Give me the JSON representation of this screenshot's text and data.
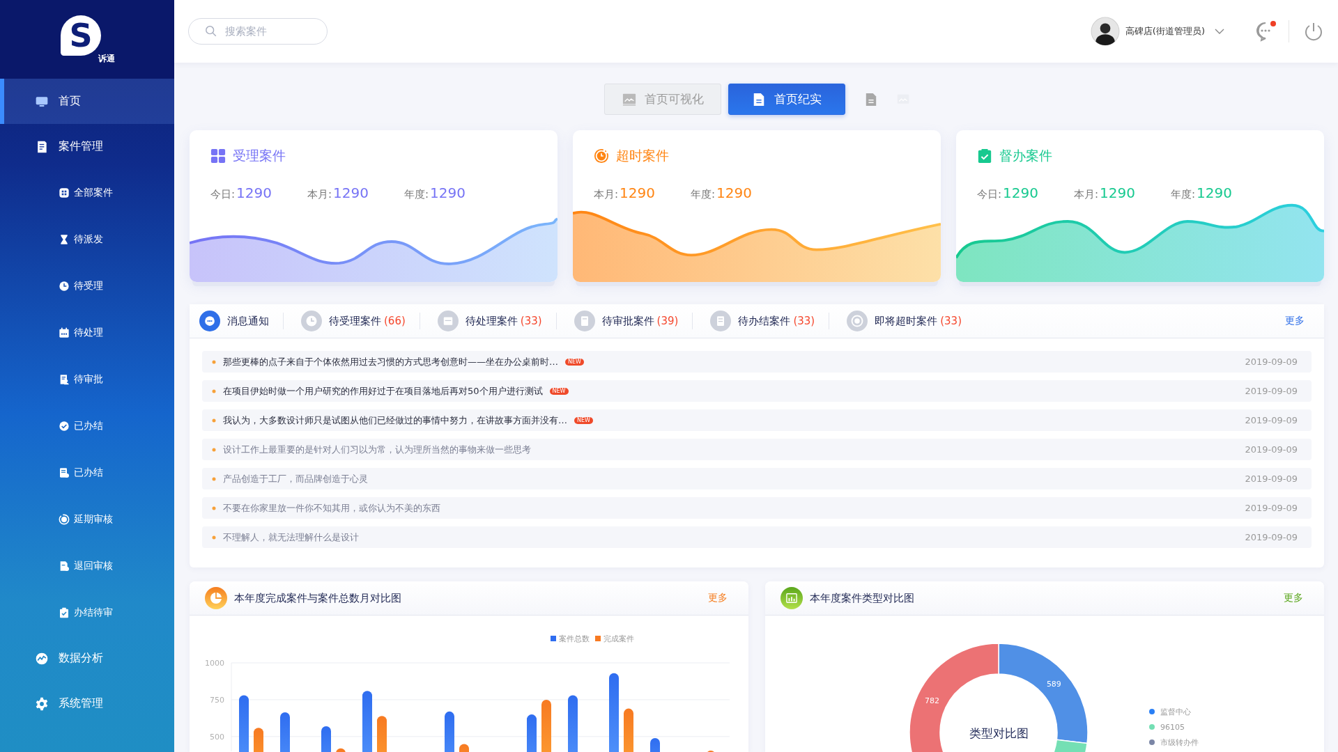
{
  "logo": {
    "mark": "S",
    "name": "诉通"
  },
  "sidebar": {
    "items": [
      {
        "label": "首页",
        "selected": true
      },
      {
        "label": "案件管理",
        "selected": false,
        "expanded": true,
        "children": [
          {
            "label": "全部案件",
            "selected": false
          },
          {
            "label": "待派发",
            "selected": false
          },
          {
            "label": "待受理",
            "selected": false
          },
          {
            "label": "待处理",
            "selected": false
          },
          {
            "label": "待审批",
            "selected": false
          },
          {
            "label": "已办结",
            "selected": false
          },
          {
            "label": "已办结",
            "selected": false
          },
          {
            "label": "延期审核",
            "selected": false
          },
          {
            "label": "退回审核",
            "selected": false
          },
          {
            "label": "办结待审",
            "selected": false
          }
        ]
      },
      {
        "label": "数据分析",
        "selected": false
      },
      {
        "label": "系统管理",
        "selected": false
      }
    ]
  },
  "search": {
    "placeholder": "搜索案件"
  },
  "user": {
    "name": "高碑店(街道管理员)"
  },
  "messages": {
    "unread": true
  },
  "view_tabs": [
    {
      "label": "首页可视化",
      "selected": false
    },
    {
      "label": "首页纪实",
      "selected": true
    }
  ],
  "cards": [
    {
      "title": "受理案件",
      "color": "#7673f5",
      "stats": [
        {
          "label": "今日:",
          "value": "1290"
        },
        {
          "label": "本月:",
          "value": "1290"
        },
        {
          "label": "年度:",
          "value": "1290"
        }
      ]
    },
    {
      "title": "超时案件",
      "color": "#ff8513",
      "stats": [
        {
          "label": "本月:",
          "value": "1290"
        },
        {
          "label": "年度:",
          "value": "1290"
        }
      ]
    },
    {
      "title": "督办案件",
      "color": "#17c98f",
      "stats": [
        {
          "label": "今日:",
          "value": "1290"
        },
        {
          "label": "本月:",
          "value": "1290"
        },
        {
          "label": "年度:",
          "value": "1290"
        }
      ]
    }
  ],
  "notice": {
    "tabs": [
      {
        "label": "消息通知",
        "selected": true
      },
      {
        "label": "待受理案件",
        "count": "(66)",
        "selected": false
      },
      {
        "label": "待处理案件",
        "count": "(33)",
        "selected": false
      },
      {
        "label": "待审批案件",
        "count": "(39)",
        "selected": false
      },
      {
        "label": "待办结案件",
        "count": "(33)",
        "selected": false
      },
      {
        "label": "即将超时案件",
        "count": "(33)",
        "selected": false
      }
    ],
    "more": "更多",
    "items": [
      {
        "text": "那些更棒的点子来自于个体依然用过去习惯的方式思考创意时——坐在办公桌前时…",
        "unread": true,
        "badge": "NEW",
        "date": "2019-09-09"
      },
      {
        "text": "在项目伊始时做一个用户研究的作用好过于在项目落地后再对50个用户进行测试",
        "unread": true,
        "badge": "NEW",
        "date": "2019-09-09"
      },
      {
        "text": "我认为，大多数设计师只是试图从他们已经做过的事情中努力，在讲故事方面并没有…",
        "unread": true,
        "badge": "NEW",
        "date": "2019-09-09"
      },
      {
        "text": "设计工作上最重要的是针对人们习以为常，认为理所当然的事物来做一些思考",
        "unread": false,
        "date": "2019-09-09"
      },
      {
        "text": "产品创造于工厂，而品牌创造于心灵",
        "unread": false,
        "date": "2019-09-09"
      },
      {
        "text": "不要在你家里放一件你不知其用，或你认为不美的东西",
        "unread": false,
        "date": "2019-09-09"
      },
      {
        "text": "不理解人，就无法理解什么是设计",
        "unread": false,
        "date": "2019-09-09"
      }
    ]
  },
  "bar_panel": {
    "title": "本年度完成案件与案件总数月对比图",
    "more": "更多",
    "chart_data": {
      "type": "bar",
      "ylim": [
        400,
        1000
      ],
      "yticks": [
        500,
        750,
        1000
      ],
      "stacked": false,
      "legend": "top-right",
      "series": [
        {
          "name": "案件总数",
          "color": "#2f6df0",
          "values": [
            780,
            665,
            570,
            810,
            null,
            670,
            null,
            650,
            780,
            930,
            490,
            null
          ]
        },
        {
          "name": "完成案件",
          "color": "#f77a22",
          "values": [
            560,
            null,
            420,
            640,
            null,
            450,
            null,
            750,
            null,
            690,
            null,
            405
          ]
        }
      ]
    }
  },
  "donut_panel": {
    "title": "本年度案件类型对比图",
    "more": "更多",
    "chart_data": {
      "type": "donut",
      "title": "类型对比图",
      "values": [
        589,
        815,
        782
      ],
      "value_labels": [
        "589",
        null,
        "782"
      ],
      "colors": [
        "#5090e6",
        "#74dfb4",
        "#ec7274"
      ]
    },
    "legend": [
      {
        "label": "监督中心",
        "color": "#2a7ff5"
      },
      {
        "label": "96105",
        "color": "#74dfb4"
      },
      {
        "label": "市级转办件",
        "color": "#7b86a6"
      }
    ]
  }
}
